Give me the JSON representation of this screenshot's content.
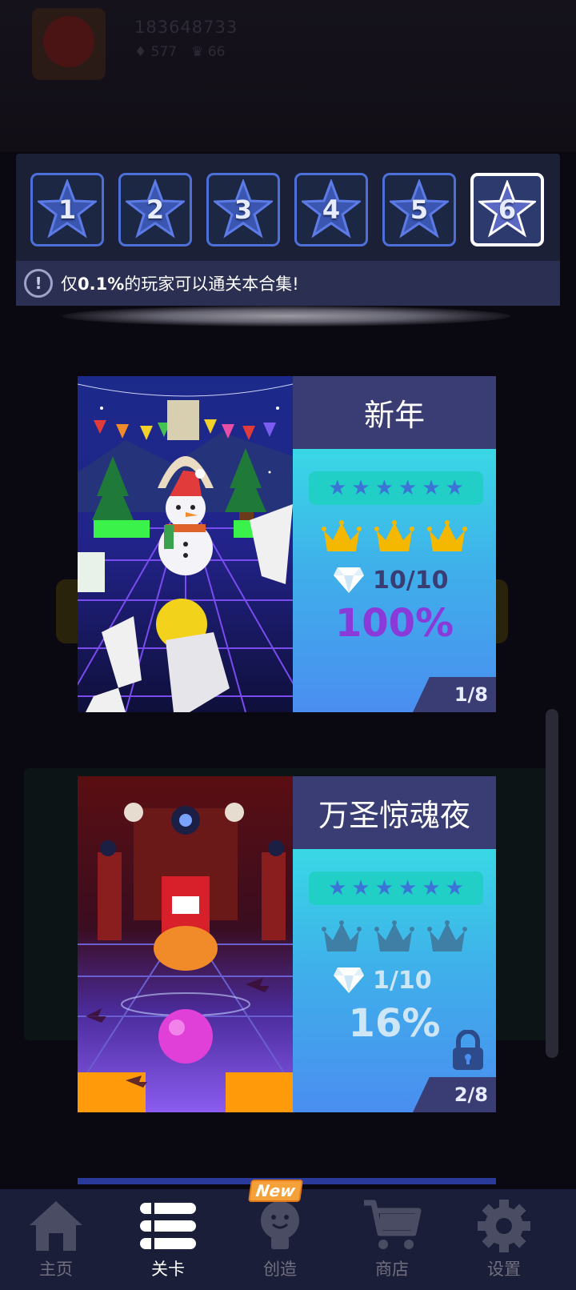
{
  "background": {
    "user_id": "183648733",
    "gems": "577",
    "crowns": "66"
  },
  "stage_selector": {
    "stages": [
      {
        "label": "1",
        "selected": false
      },
      {
        "label": "2",
        "selected": false
      },
      {
        "label": "3",
        "selected": false
      },
      {
        "label": "4",
        "selected": false
      },
      {
        "label": "5",
        "selected": false
      },
      {
        "label": "6",
        "selected": true
      }
    ],
    "notice_prefix": "仅",
    "notice_highlight": "0.1%",
    "notice_suffix": "的玩家可以通关本合集!"
  },
  "levels": [
    {
      "title": "新年",
      "stars_filled": 6,
      "crowns_earned": 3,
      "gems_text": "10/10",
      "percent": "100%",
      "page": "1/8",
      "locked": false
    },
    {
      "title": "万圣惊魂夜",
      "stars_filled": 6,
      "crowns_earned": 0,
      "gems_text": "1/10",
      "percent": "16%",
      "page": "2/8",
      "locked": true
    }
  ],
  "colors": {
    "crown_gold": "#f5b800",
    "crown_dim": "#3f7fa6",
    "percent_full": "#8a3ad8",
    "percent_partial": "#cfe6f7",
    "accent_blue": "#4c6fd8"
  },
  "bottom_nav": {
    "items": [
      {
        "label": "主页",
        "icon": "home-icon"
      },
      {
        "label": "关卡",
        "icon": "levels-list-icon",
        "active": true
      },
      {
        "label": "创造",
        "icon": "create-bulb-icon",
        "badge": "New"
      },
      {
        "label": "商店",
        "icon": "shop-cart-icon"
      },
      {
        "label": "设置",
        "icon": "settings-gear-icon"
      }
    ]
  }
}
